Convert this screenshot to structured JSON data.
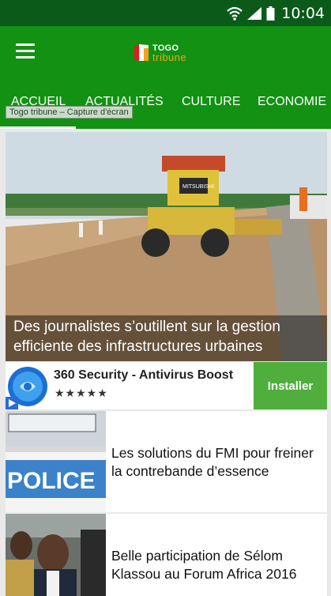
{
  "status_bar": {
    "time": "10:04"
  },
  "app_bar": {
    "logo_line1": "TOGO",
    "logo_line2": "tribune",
    "tabs": [
      {
        "label": "ACCUEIL",
        "active": true
      },
      {
        "label": "ACTUALITÉS",
        "active": false
      },
      {
        "label": "CULTURE",
        "active": false
      },
      {
        "label": "ECONOMIE",
        "active": false
      }
    ],
    "tooltip": "Togo tribune – Capture d'écran"
  },
  "hero": {
    "headline": "Des journalistes s’outillent sur la gestion efficiente des infrastructures urbaines",
    "image_text": "MITSUBISHI"
  },
  "ad": {
    "title": "360 Security - Antivirus Boost",
    "stars": "★★★★★",
    "install_label": "Installer"
  },
  "articles": [
    {
      "title": "Les solutions du FMI pour freiner la contrebande d’essence",
      "image_text": "POLICE"
    },
    {
      "title": "Belle participation de Sélom Klassou au Forum Africa 2016"
    }
  ],
  "colors": {
    "status_bar": "#0b5a1a",
    "app_bar": "#129112",
    "install_button": "#4fae3c",
    "logo_accent": "#f6a21a"
  }
}
